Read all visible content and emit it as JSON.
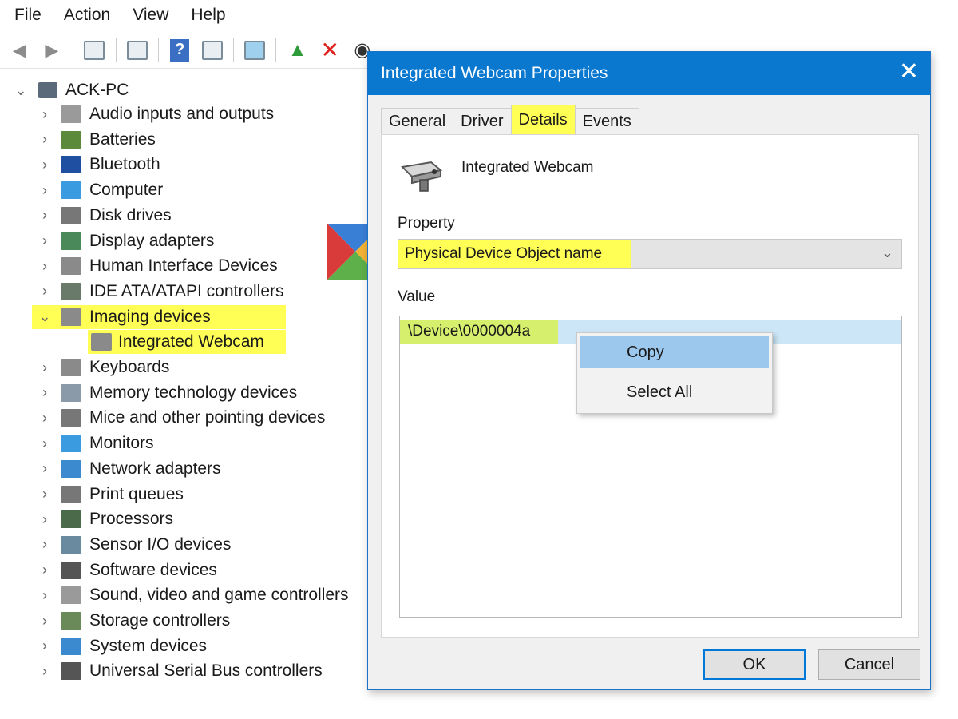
{
  "menu": [
    "File",
    "Action",
    "View",
    "Help"
  ],
  "toolbar": {
    "icons": [
      "back-arrow-icon",
      "forward-arrow-icon",
      "properties-icon",
      "console-tree-icon",
      "help-icon",
      "action-pane-icon",
      "monitor-icon",
      "update-driver-icon",
      "uninstall-icon",
      "scan-hardware-icon"
    ]
  },
  "tree": {
    "root": "ACK-PC",
    "items": [
      {
        "label": "Audio inputs and outputs",
        "icon": "speaker-icon",
        "color": "#9a9a9a"
      },
      {
        "label": "Batteries",
        "icon": "battery-icon",
        "color": "#5a8a3a"
      },
      {
        "label": "Bluetooth",
        "icon": "bluetooth-icon",
        "color": "#1f4fa0"
      },
      {
        "label": "Computer",
        "icon": "computer-icon",
        "color": "#3b9be0"
      },
      {
        "label": "Disk drives",
        "icon": "disk-drive-icon",
        "color": "#777777"
      },
      {
        "label": "Display adapters",
        "icon": "display-adapter-icon",
        "color": "#4a8a5a"
      },
      {
        "label": "Human Interface Devices",
        "icon": "hid-icon",
        "color": "#8a8a8a"
      },
      {
        "label": "IDE ATA/ATAPI controllers",
        "icon": "ide-controller-icon",
        "color": "#6a7a6a"
      },
      {
        "label": "Imaging devices",
        "icon": "camera-icon",
        "color": "#8a8a8a",
        "expanded": true,
        "highlighted": true
      },
      {
        "label": "Keyboards",
        "icon": "keyboard-icon",
        "color": "#8a8a8a"
      },
      {
        "label": "Memory technology devices",
        "icon": "memory-icon",
        "color": "#8a9aa8"
      },
      {
        "label": "Mice and other pointing devices",
        "icon": "mouse-icon",
        "color": "#777777"
      },
      {
        "label": "Monitors",
        "icon": "monitor-icon",
        "color": "#3b9be0"
      },
      {
        "label": "Network adapters",
        "icon": "network-adapter-icon",
        "color": "#3b8ad0"
      },
      {
        "label": "Print queues",
        "icon": "printer-icon",
        "color": "#777777"
      },
      {
        "label": "Processors",
        "icon": "processor-icon",
        "color": "#4a6a4a"
      },
      {
        "label": "Sensor I/O devices",
        "icon": "sensor-icon",
        "color": "#6a8aa0"
      },
      {
        "label": "Software devices",
        "icon": "software-device-icon",
        "color": "#555555"
      },
      {
        "label": "Sound, video and game controllers",
        "icon": "sound-icon",
        "color": "#9a9a9a"
      },
      {
        "label": "Storage controllers",
        "icon": "storage-controller-icon",
        "color": "#6a8a5a"
      },
      {
        "label": "System devices",
        "icon": "system-device-icon",
        "color": "#3b8ad0"
      },
      {
        "label": "Universal Serial Bus controllers",
        "icon": "usb-icon",
        "color": "#555555"
      }
    ],
    "child": {
      "label": "Integrated Webcam",
      "icon": "camera-icon"
    }
  },
  "dialog": {
    "title": "Integrated Webcam Properties",
    "tabs": [
      "General",
      "Driver",
      "Details",
      "Events"
    ],
    "active_tab": "Details",
    "device_name": "Integrated Webcam",
    "property_label": "Property",
    "property_value": "Physical Device Object name",
    "value_label": "Value",
    "value": "\\Device\\0000004a",
    "ok": "OK",
    "cancel": "Cancel"
  },
  "context_menu": {
    "items": [
      "Copy",
      "Select All"
    ],
    "selected": "Copy"
  },
  "colors": {
    "accent": "#0b78d0",
    "highlight": "#ffff55",
    "selection": "#cde6f7",
    "menu_selected": "#9cc8ee"
  }
}
